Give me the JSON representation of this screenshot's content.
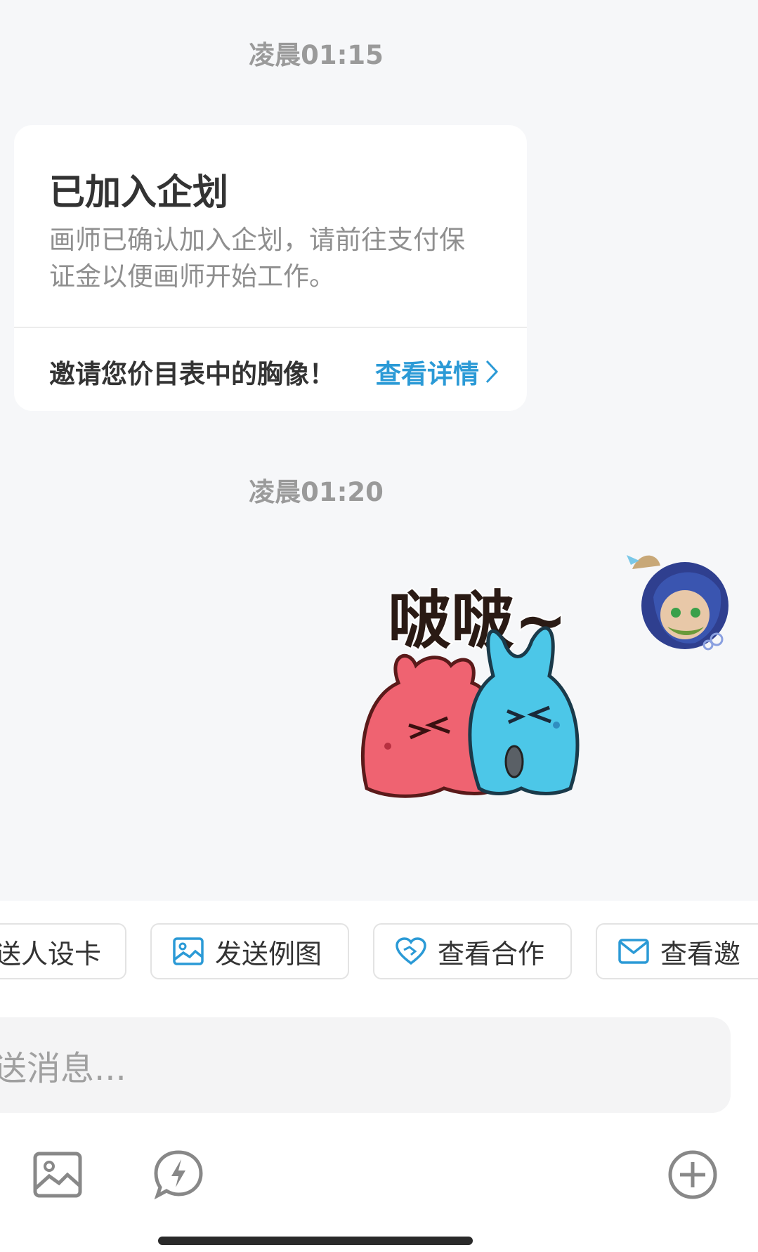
{
  "messages": {
    "ts1": "凌晨01:15",
    "ts2": "凌晨01:20"
  },
  "card": {
    "title": "已加入企划",
    "desc": "画师已确认加入企划，请前往支付保证金以便画师开始工作。",
    "footer": "邀请您价目表中的胸像！",
    "link": "查看详情"
  },
  "sticker": {
    "text": "啵啵~"
  },
  "quick_actions": [
    {
      "label": "送人设卡",
      "icon": "card-icon"
    },
    {
      "label": "发送例图",
      "icon": "image-icon"
    },
    {
      "label": "查看合作",
      "icon": "handshake-heart-icon"
    },
    {
      "label": "查看邀",
      "icon": "mail-icon"
    }
  ],
  "input": {
    "placeholder": "送消息..."
  },
  "toolbar": [
    "image-icon",
    "lightning-chat-icon",
    "plus-circle-icon"
  ],
  "colors": {
    "accent": "#2b9ad6",
    "background": "#f6f7f9"
  }
}
